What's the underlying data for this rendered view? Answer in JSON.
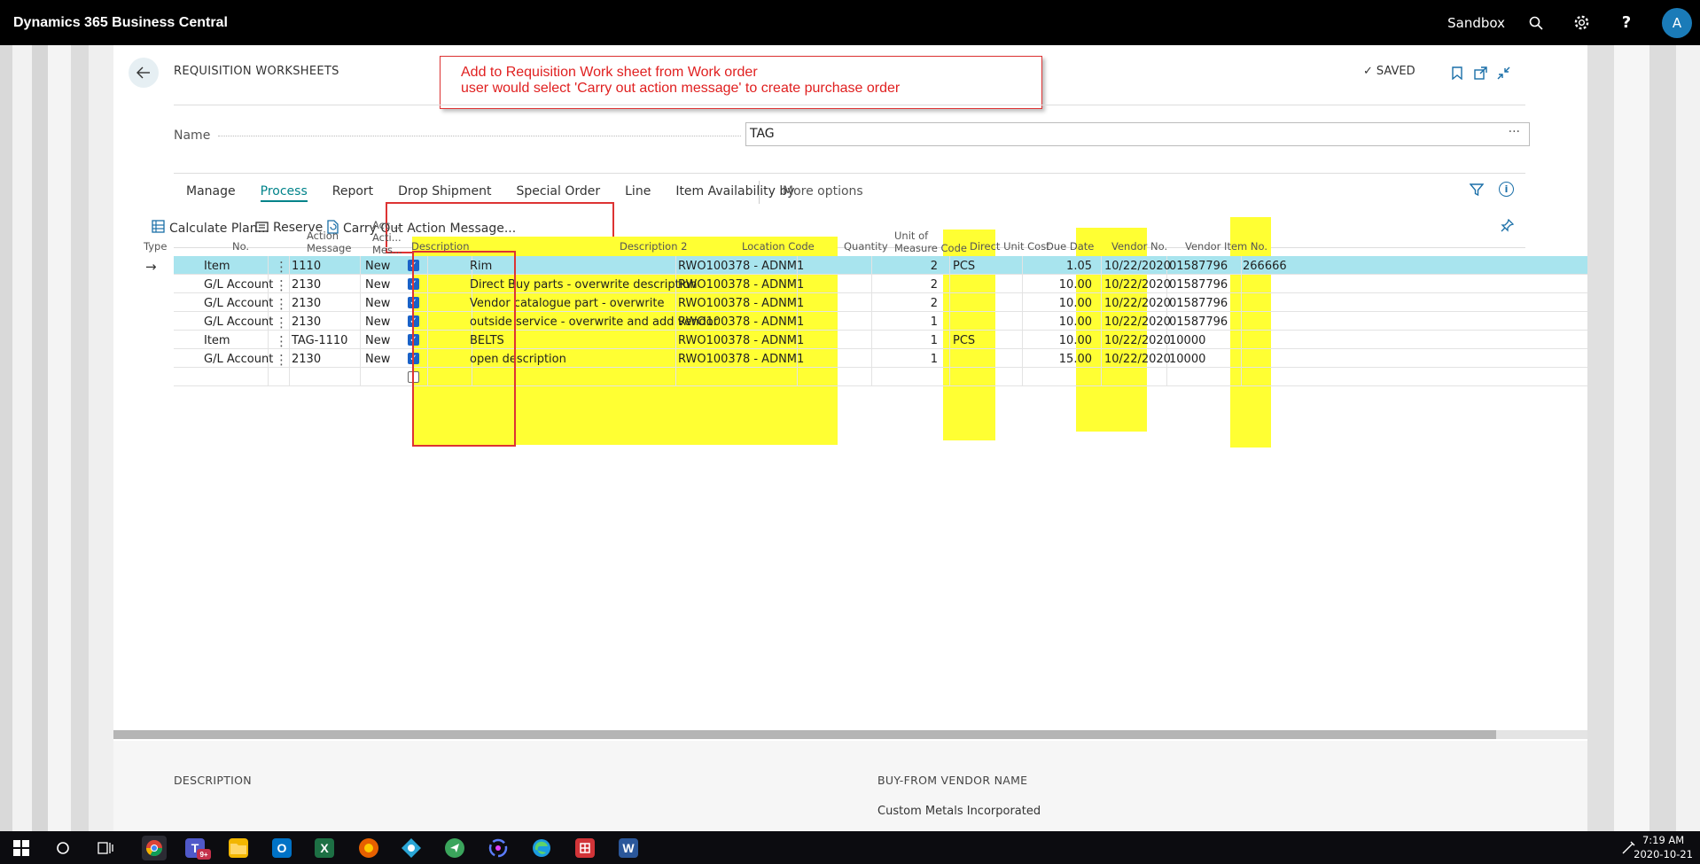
{
  "app": {
    "title": "Dynamics 365 Business Central",
    "environment": "Sandbox",
    "avatar": "A"
  },
  "page": {
    "title": "REQUISITION WORKSHEETS",
    "status": "SAVED",
    "callout": {
      "line1": "Add to Requisition Work sheet from Work order",
      "line2": "user would select 'Carry out action message' to create purchase order"
    },
    "name_label": "Name",
    "name_value": "TAG"
  },
  "tabs": [
    "Manage",
    "Process",
    "Report",
    "Drop Shipment",
    "Special Order",
    "Line",
    "Item Availability by"
  ],
  "active_tab": "Process",
  "more_options": "More options",
  "commands": {
    "calculate": "Calculate Plan...",
    "reserve": "Reserve",
    "carry_out": "Carry Out Action Message..."
  },
  "columns": {
    "type": "Type",
    "no": "No.",
    "action_message_1": "Action",
    "action_message_2": "Message",
    "accept_1": "Acc...",
    "accept_2": "Acti...",
    "accept_3": "Mes...",
    "description": "Description",
    "description2": "Description 2",
    "location": "Location Code",
    "quantity": "Quantity",
    "uom_1": "Unit of",
    "uom_2": "Measure Code",
    "direct_unit_cost": "Direct Unit Cost",
    "due_date": "Due Date",
    "vendor_no": "Vendor No.",
    "vendor_item_no": "Vendor Item No."
  },
  "rows": [
    {
      "type": "Item",
      "no": "1110",
      "action": "New",
      "accept": true,
      "description": "Rim",
      "description2": "RWO100378 - ADNM1",
      "location": "",
      "quantity": "2",
      "uom": "PCS",
      "cost": "1.05",
      "due": "10/22/2020",
      "vendor": "01587796",
      "vendor_item": "266666"
    },
    {
      "type": "G/L Account",
      "no": "2130",
      "action": "New",
      "accept": true,
      "description": "Direct Buy parts - overwrite description",
      "description2": "RWO100378 - ADNM1",
      "location": "",
      "quantity": "2",
      "uom": "",
      "cost": "10.00",
      "due": "10/22/2020",
      "vendor": "01587796",
      "vendor_item": ""
    },
    {
      "type": "G/L Account",
      "no": "2130",
      "action": "New",
      "accept": true,
      "description": "Vendor catalogue part - overwrite",
      "description2": "RWO100378 - ADNM1",
      "location": "",
      "quantity": "2",
      "uom": "",
      "cost": "10.00",
      "due": "10/22/2020",
      "vendor": "01587796",
      "vendor_item": ""
    },
    {
      "type": "G/L Account",
      "no": "2130",
      "action": "New",
      "accept": true,
      "description": "outside service - overwrite and add vendor",
      "description2": "RWO100378 - ADNM1",
      "location": "",
      "quantity": "1",
      "uom": "",
      "cost": "10.00",
      "due": "10/22/2020",
      "vendor": "01587796",
      "vendor_item": ""
    },
    {
      "type": "Item",
      "no": "TAG-1110",
      "action": "New",
      "accept": true,
      "description": "BELTS",
      "description2": "RWO100378 - ADNM1",
      "location": "",
      "quantity": "1",
      "uom": "PCS",
      "cost": "10.00",
      "due": "10/22/2020",
      "vendor": "10000",
      "vendor_item": ""
    },
    {
      "type": "G/L Account",
      "no": "2130",
      "action": "New",
      "accept": true,
      "description": "open description",
      "description2": "RWO100378 - ADNM1",
      "location": "",
      "quantity": "1",
      "uom": "",
      "cost": "15.00",
      "due": "10/22/2020",
      "vendor": "10000",
      "vendor_item": ""
    }
  ],
  "footer": {
    "description_label": "DESCRIPTION",
    "vendor_label": "BUY-FROM VENDOR NAME",
    "vendor_value": "Custom Metals Incorporated"
  },
  "taskbar": {
    "time": "7:19 AM",
    "date": "2020-10-21",
    "teams_badge": "9+"
  }
}
